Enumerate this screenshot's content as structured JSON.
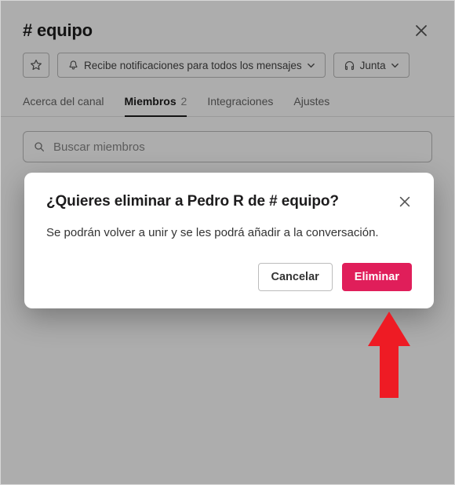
{
  "header": {
    "channel_name": "# equipo"
  },
  "actions": {
    "notifications_label": "Recibe notificaciones para todos los mensajes",
    "huddle_label": "Junta"
  },
  "tabs": {
    "about": "Acerca del canal",
    "members": "Miembros",
    "members_count": "2",
    "integrations": "Integraciones",
    "settings": "Ajustes"
  },
  "search": {
    "placeholder": "Buscar miembros"
  },
  "modal": {
    "title": "¿Quieres eliminar a Pedro R de # equipo?",
    "body": "Se podrán volver a unir y se les podrá añadir a la conversación.",
    "cancel": "Cancelar",
    "confirm": "Eliminar"
  }
}
